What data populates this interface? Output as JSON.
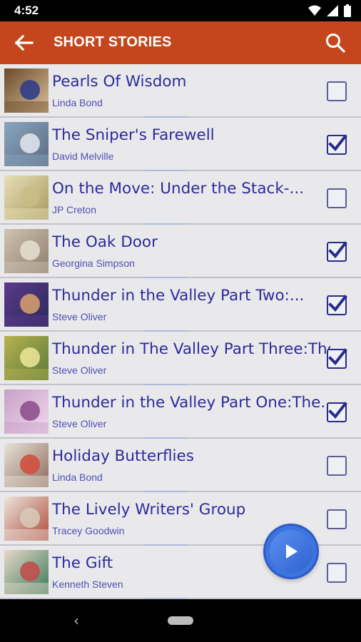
{
  "status_bar": {
    "time": "4:52",
    "icons": [
      "wifi-icon",
      "signal-icon",
      "battery-icon"
    ]
  },
  "app_bar": {
    "title": "SHORT STORIES",
    "back_icon": "arrow-left-icon",
    "search_icon": "search-icon"
  },
  "stories": [
    {
      "title": "Pearls Of Wisdom",
      "author": "Linda Bond",
      "checked": false,
      "thumb_colors": [
        "#6b4a2a",
        "#2a3a8a",
        "#d9c09a"
      ]
    },
    {
      "title": "The Sniper's Farewell",
      "author": "David Melville",
      "checked": true,
      "thumb_colors": [
        "#8aa6c0",
        "#e7e7ef",
        "#5a6a80"
      ]
    },
    {
      "title": "On the Move: Under the Stack-...",
      "author": "JP Creton",
      "checked": false,
      "thumb_colors": [
        "#e6dfb8",
        "#c9bc86",
        "#a89a5c"
      ]
    },
    {
      "title": "The Oak Door",
      "author": "Georgina Simpson",
      "checked": true,
      "thumb_colors": [
        "#cfc3b3",
        "#e8e0d2",
        "#8e7e6c"
      ]
    },
    {
      "title": "Thunder in the Valley Part Two:...",
      "author": "Steve Oliver",
      "checked": true,
      "thumb_colors": [
        "#5a3a8a",
        "#d9a26a",
        "#2a2a5a"
      ]
    },
    {
      "title": "Thunder in The Valley Part Three:The",
      "author": "Steve Oliver",
      "checked": true,
      "thumb_colors": [
        "#b8b250",
        "#ece79a",
        "#5a7a3a"
      ]
    },
    {
      "title": "Thunder in the Valley Part One:The...",
      "author": "Steve Oliver",
      "checked": true,
      "thumb_colors": [
        "#c7a0c7",
        "#8a4a8a",
        "#f1d9ee"
      ]
    },
    {
      "title": "Holiday Butterflies",
      "author": "Linda Bond",
      "checked": false,
      "thumb_colors": [
        "#e8e2da",
        "#d24a3a",
        "#8a6a5a"
      ]
    },
    {
      "title": "The Lively Writers' Group",
      "author": "Tracey Goodwin",
      "checked": false,
      "thumb_colors": [
        "#eae5dd",
        "#d8cbb9",
        "#b04a3a"
      ]
    },
    {
      "title": "The Gift",
      "author": "Kenneth Steven",
      "checked": false,
      "thumb_colors": [
        "#e7d8c8",
        "#c24a4a",
        "#3a7a5a"
      ]
    }
  ],
  "fab": {
    "icon": "play-icon",
    "color": "#3c74e0"
  },
  "nav_bar": {
    "back_icon": "nav-back-icon",
    "home_icon": "nav-home-pill-icon"
  },
  "colors": {
    "app_bar": "#c5461c",
    "title_text": "#2d2a9a",
    "author_text": "#4e4fb2"
  }
}
